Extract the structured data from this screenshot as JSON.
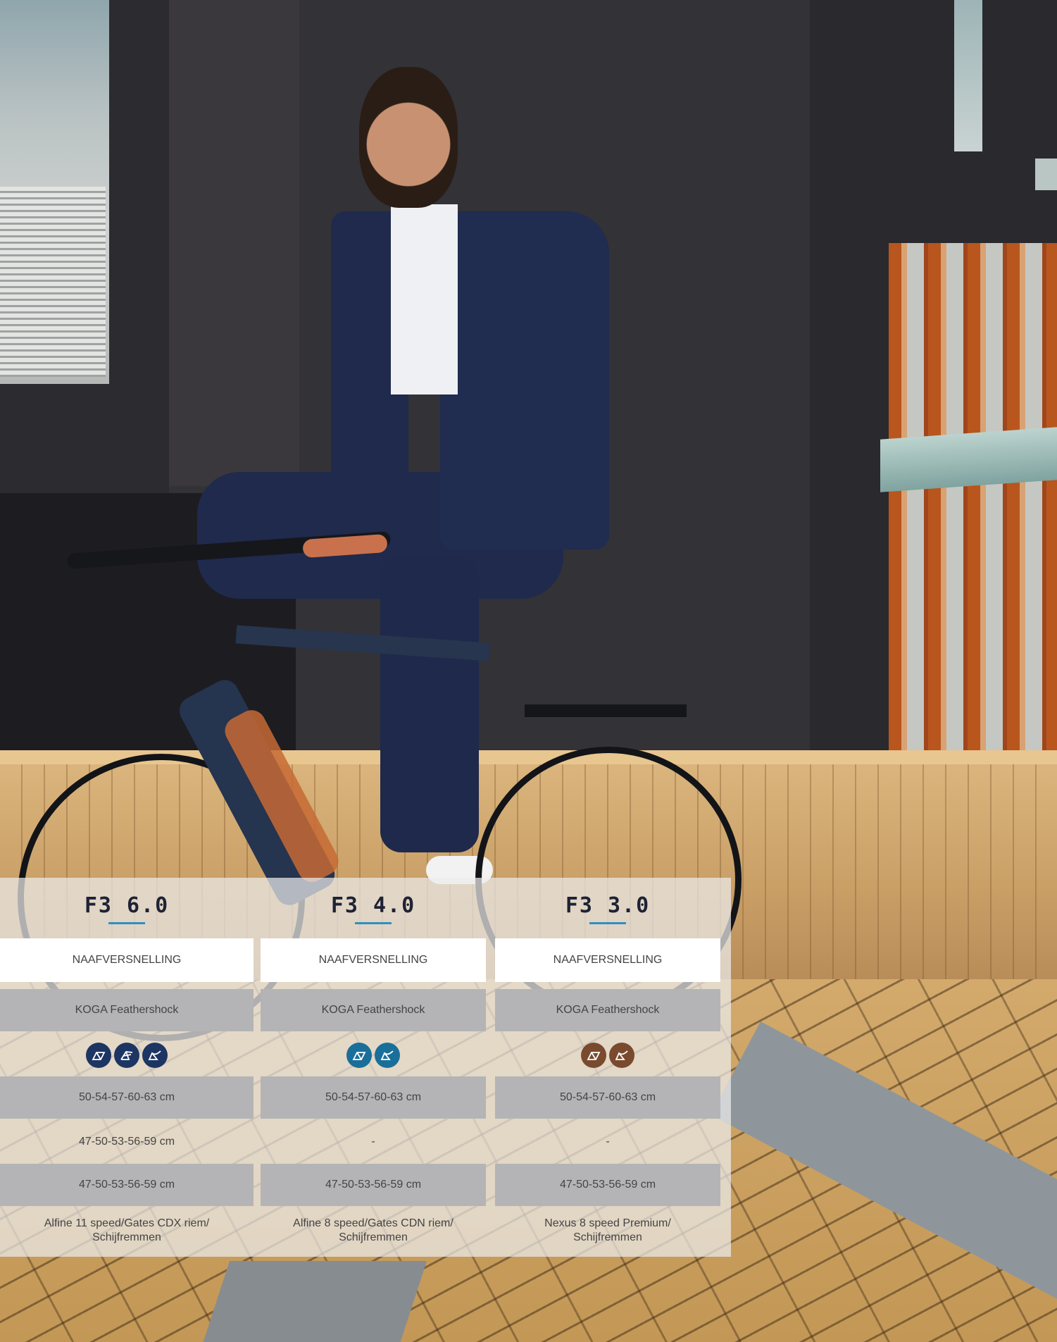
{
  "models": [
    {
      "name": "F3 6.0",
      "gearing": "NAAFVERSNELLING",
      "suspension": "KOGA Feathershock",
      "frame_icons": [
        "frame-heren-icon",
        "frame-dames-icon",
        "frame-lage-instap-icon"
      ],
      "icon_color": "#1c3563",
      "size_heren": "50-54-57-60-63 cm",
      "size_dames": "47-50-53-56-59 cm",
      "size_lage_instap": "47-50-53-56-59 cm",
      "drivetrain": [
        "Alfine 11 speed/Gates CDX riem/",
        "Schijfremmen"
      ]
    },
    {
      "name": "F3 4.0",
      "gearing": "NAAFVERSNELLING",
      "suspension": "KOGA Feathershock",
      "frame_icons": [
        "frame-heren-icon",
        "frame-lage-instap-icon"
      ],
      "icon_color": "#1a6e9a",
      "size_heren": "50-54-57-60-63 cm",
      "size_dames": "-",
      "size_lage_instap": "47-50-53-56-59 cm",
      "drivetrain": [
        "Alfine 8 speed/Gates CDN riem/",
        "Schijfremmen"
      ]
    },
    {
      "name": "F3 3.0",
      "gearing": "NAAFVERSNELLING",
      "suspension": "KOGA Feathershock",
      "frame_icons": [
        "frame-heren-icon",
        "frame-lage-instap-icon"
      ],
      "icon_color": "#7a4a2e",
      "size_heren": "50-54-57-60-63 cm",
      "size_dames": "-",
      "size_lage_instap": "47-50-53-56-59 cm",
      "drivetrain": [
        "Nexus 8 speed Premium/",
        "Schijfremmen"
      ]
    }
  ],
  "colors": {
    "title_underline": "#2f8ec4",
    "row_gray": "#b4b4b6",
    "row_white": "#ffffff"
  }
}
